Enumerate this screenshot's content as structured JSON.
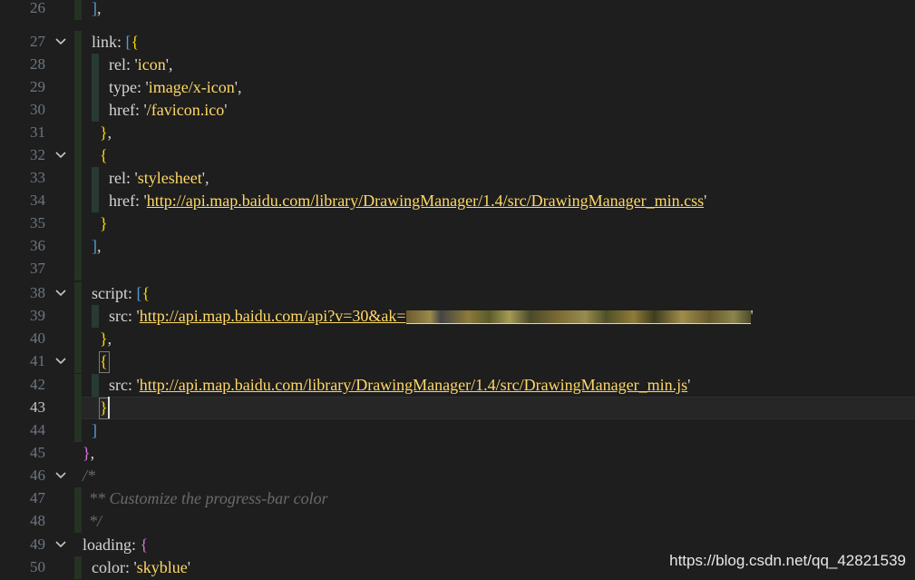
{
  "editor": {
    "lines": [
      {
        "n": "26"
      },
      {
        "n": "27"
      },
      {
        "n": "28"
      },
      {
        "n": "29"
      },
      {
        "n": "30"
      },
      {
        "n": "31"
      },
      {
        "n": "32"
      },
      {
        "n": "33"
      },
      {
        "n": "34"
      },
      {
        "n": "35"
      },
      {
        "n": "36"
      },
      {
        "n": "37"
      },
      {
        "n": "38"
      },
      {
        "n": "39"
      },
      {
        "n": "40"
      },
      {
        "n": "41"
      },
      {
        "n": "42"
      },
      {
        "n": "43"
      },
      {
        "n": "44"
      },
      {
        "n": "45"
      },
      {
        "n": "46"
      },
      {
        "n": "47"
      },
      {
        "n": "48"
      },
      {
        "n": "49"
      },
      {
        "n": "50"
      }
    ],
    "tokens": {
      "link": "link",
      "rel": "rel",
      "type": "type",
      "href": "href",
      "icon": "icon",
      "image_xicon": "image/x-icon",
      "favicon": "/favicon.ico",
      "stylesheet": "stylesheet",
      "css_url": "http://api.map.baidu.com/library/DrawingManager/1.4/src/DrawingManager_min.css",
      "script": "script",
      "src": "src",
      "api_url": "http://api.map.baidu.com/api?v=30&ak=",
      "js_url": "http://api.map.baidu.com/library/DrawingManager/1.4/src/DrawingManager_min.js",
      "comment_open": "/*",
      "comment_body": "** Customize the progress-bar color",
      "comment_close": "*/",
      "loading": "loading",
      "color": "color",
      "skyblue": "skyblue"
    },
    "current_line": "43"
  },
  "watermark": "https://blog.csdn.net/qq_42821539"
}
